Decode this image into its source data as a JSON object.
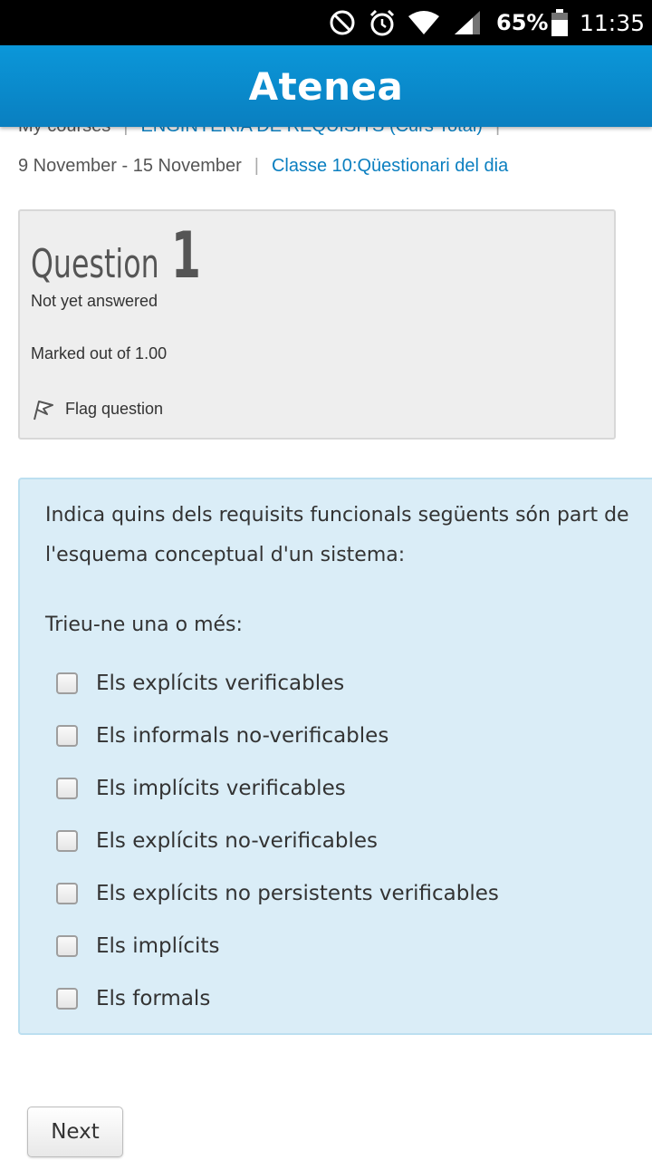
{
  "status_bar": {
    "battery_percent": "65%",
    "time": "11:35",
    "icons": [
      "do-not-disturb-icon",
      "alarm-icon",
      "wifi-icon",
      "cell-signal-icon",
      "battery-icon"
    ]
  },
  "header": {
    "title": "Atenea",
    "color": "#0b8ccf"
  },
  "breadcrumb": {
    "items": [
      {
        "label": "My courses",
        "link": false
      },
      {
        "label": "ENGINYERIA DE REQUISITS (Curs Total)",
        "link": true
      },
      {
        "label": "9 November - 15 November",
        "link": false
      },
      {
        "label": "Classe 10:Qüestionari del dia",
        "link": true
      }
    ]
  },
  "question_info": {
    "word": "Question",
    "number": "1",
    "state": "Not yet answered",
    "grade": "Marked out of 1.00",
    "flag_label": "Flag question"
  },
  "question": {
    "text": "Indica quins dels requisits funcionals següents són part de l'esquema conceptual d'un sistema:",
    "prompt": "Trieu-ne una o més:",
    "answers": [
      {
        "label": "Els explícits verificables",
        "checked": false
      },
      {
        "label": "Els informals no-verificables",
        "checked": false
      },
      {
        "label": "Els implícits verificables",
        "checked": false
      },
      {
        "label": "Els explícits no-verificables",
        "checked": false
      },
      {
        "label": "Els explícits no persistents verificables",
        "checked": false
      },
      {
        "label": "Els implícits",
        "checked": false
      },
      {
        "label": "Els formals",
        "checked": false
      }
    ]
  },
  "navigation": {
    "next_label": "Next"
  }
}
